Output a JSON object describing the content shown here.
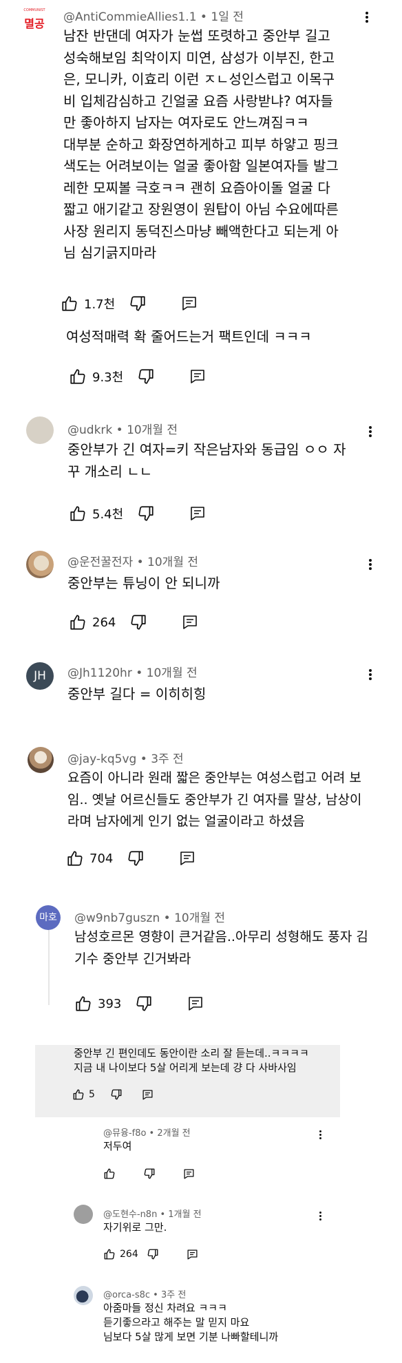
{
  "comments": [
    {
      "author": "@AntiCommieAllies1.1",
      "time": "1일 전",
      "avatar_text": "멸공",
      "avatar_small_text": "COMMUNIST",
      "lines": [
        "남잔 반댄데 여자가 눈썹 또렷하고 중안부 길고",
        "성숙해보임 최악이지 미연, 삼성가 이부진, 한고",
        "은, 모니카, 이효리 이런 ㅈㄴ성인스럽고 이목구",
        "비 입체감심하고 긴얼굴 요즘 사랑받냐? 여자들",
        "만 좋아하지 남자는 여자로도 안느껴짐ㅋㅋ",
        "대부분 순하고 화장연하게하고 피부 하얗고 핑크",
        "색도는 어려보이는 얼굴 좋아함 일본여자들 발그",
        "레한 모찌볼 극호ㅋㅋ 괜히 요즘아이돌 얼굴 다",
        "짧고 애기같고 장원영이 원탑이 아님 수요에따른",
        "사장 원리지 동덕진스마냥 빼액한다고 되는게 아",
        "님 심기긁지마라"
      ],
      "likes": "1.7천"
    },
    {
      "author": "",
      "time": "",
      "lines": [
        "여성적매력 확 줄어드는거 팩트인데 ㅋㅋㅋ"
      ],
      "likes": "9.3천"
    },
    {
      "author": "@udkrk",
      "time": "10개월 전",
      "lines": [
        "중안부가 긴 여자=키 작은남자와 동급임 ㅇㅇ 자",
        "꾸 개소리 ㄴㄴ"
      ],
      "likes": "5.4천"
    },
    {
      "author": "@운전꿀전자",
      "time": "10개월 전",
      "lines": [
        "중안부는 튜닝이 안 되니까"
      ],
      "likes": "264"
    },
    {
      "author": "@Jh1120hr",
      "time": "10개월 전",
      "avatar_text": "JH",
      "lines": [
        "중안부 길다 = 이히히힝"
      ],
      "likes": ""
    },
    {
      "author": "@jay-kq5vg",
      "time": "3주 전",
      "lines": [
        "요즘이 아니라 원래 짧은 중안부는 여성스럽고 어려 보",
        "임.. 옛날 어르신들도 중안부가 긴 여자를 말상, 남상이",
        "라며 남자에게 인기 없는 얼굴이라고 하셨음"
      ],
      "likes": "704"
    },
    {
      "author": "@w9nb7guszn",
      "time": "10개월 전",
      "avatar_text": "마호",
      "lines": [
        "남성호르몬 영향이 큰거같음..아무리 성형해도 풍자 김",
        "기수 중안부 긴거봐라"
      ],
      "likes": "393"
    },
    {
      "author": "",
      "time": "",
      "lines": [
        "중안부 긴 편인데도 동안이란 소리 잘 듣는데..ㅋㅋㅋㅋ",
        "지금 내 나이보다 5살 어리게 보는데 걍 다 사바사임"
      ],
      "likes": "5"
    },
    {
      "author": "@뮤융-f8o",
      "time": "2개월 전",
      "lines": [
        "저두여"
      ],
      "likes": ""
    },
    {
      "author": "@도현수-n8n",
      "time": "1개월 전",
      "lines": [
        "자기위로 그만."
      ],
      "likes": "264"
    },
    {
      "author": "@orca-s8c",
      "time": "3주 전",
      "lines": [
        "아줌마들 정신 차려요 ㅋㅋㅋ",
        "듣기좋으라고 해주는 말 믿지 마요",
        "님보다 5살 많게 보면 기분 나빠할테니까"
      ],
      "likes": ""
    }
  ],
  "icons": {
    "like": "thumbs-up-icon",
    "dislike": "thumbs-down-icon",
    "reply": "reply-icon",
    "more": "more-vert-icon"
  },
  "colors": {
    "text": "#0f0f0f",
    "meta": "#606060",
    "brand_red": "#e31b23",
    "jh_avatar": "#3c4a57",
    "maho_avatar": "#5c6bc0"
  }
}
